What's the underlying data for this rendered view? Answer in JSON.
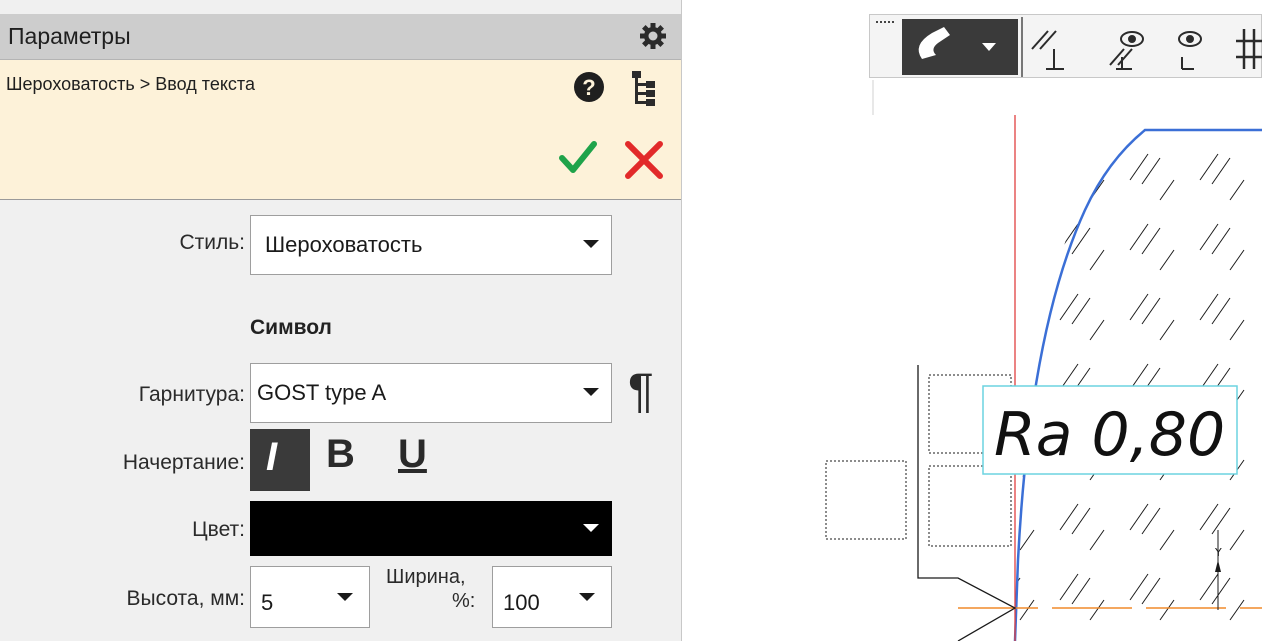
{
  "panel": {
    "title": "Параметры",
    "breadcrumb": "Шероховатость > Ввод текста"
  },
  "style": {
    "label": "Стиль:",
    "value": "Шероховатость"
  },
  "symbol_section": {
    "title": "Символ",
    "font_label": "Гарнитура:",
    "font_value": "GOST type A",
    "typeface_label": "Начертание:",
    "italic_label": "I",
    "bold_label": "B",
    "underline_label": "U",
    "color_label": "Цвет:",
    "color_value": "#000000",
    "height_label": "Высота, мм:",
    "height_value": "5",
    "width_label_line1": "Ширина,",
    "width_label_line2": "%:",
    "width_value": "100",
    "pilcrow": "¶"
  },
  "drawing": {
    "annotation_text": "Ra 0,80",
    "axis_label": "Y"
  },
  "colors": {
    "header_bg": "#cdcdcd",
    "command_bg": "#fdf2d9",
    "ok_green": "#1fa34a",
    "cancel_red": "#e22a2a",
    "contour_blue": "#3b6fd6",
    "axis_red": "#e04040",
    "axis_orange": "#f08a2a",
    "selection_cyan": "#6cd3e0"
  },
  "icons": [
    "gear-icon",
    "help-icon",
    "tree-icon",
    "check-icon",
    "close-icon",
    "magnet-icon",
    "parallel-icon",
    "eye-icon",
    "grid-icon",
    "pilcrow-icon"
  ]
}
